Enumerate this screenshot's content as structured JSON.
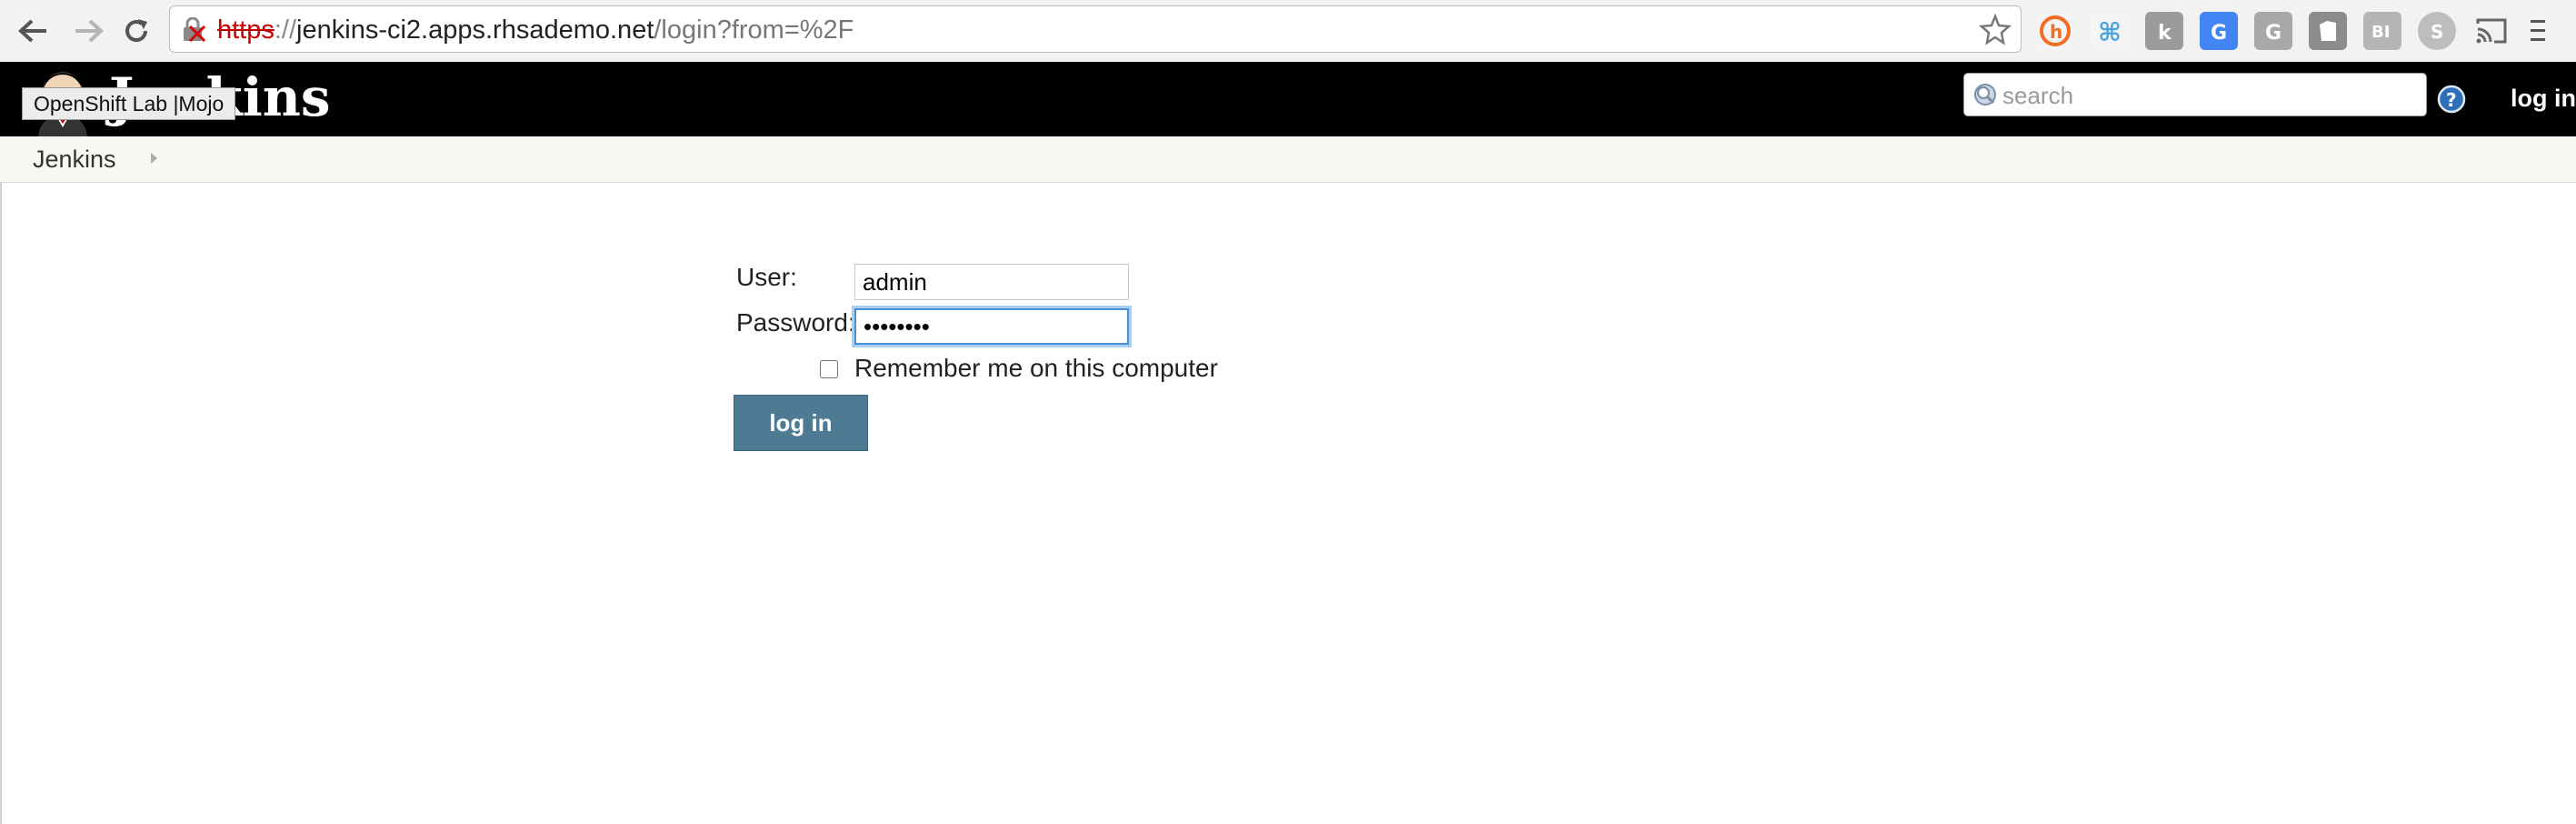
{
  "browser": {
    "url_scheme": "https",
    "url_separator": "://",
    "url_host": "jenkins-ci2.apps.rhsademo.net",
    "url_path": "/login?from=%2F",
    "extension_icons": [
      "honey-icon",
      "command-icon",
      "k-icon",
      "google-translate-icon",
      "grammarly-icon",
      "evernote-icon",
      "bi-icon",
      "skype-icon",
      "cast-icon",
      "menu-icon"
    ]
  },
  "header": {
    "title": "Jenkins",
    "tooltip": "OpenShift Lab |Mojo",
    "search_placeholder": "search",
    "login_link": "log in"
  },
  "breadcrumb": {
    "root": "Jenkins"
  },
  "login_form": {
    "user_label": "User:",
    "user_value": "admin",
    "password_label": "Password:",
    "password_value": "••••••••",
    "remember_label": "Remember me on this computer",
    "submit_label": "log in"
  },
  "colors": {
    "header_bg": "#000000",
    "breadcrumb_bg": "#f6f9f1",
    "button_bg": "#4f7a94",
    "focus_ring": "#4a90d9"
  }
}
